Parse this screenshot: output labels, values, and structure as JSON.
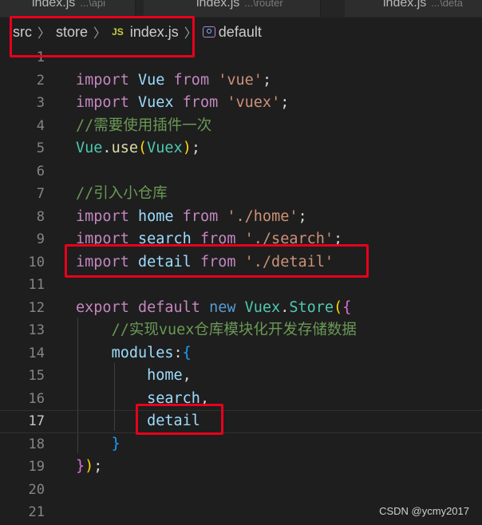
{
  "tabs": [
    {
      "name": "index.js",
      "desc": "...\\api"
    },
    {
      "name": "index.js",
      "desc": "...\\router"
    },
    {
      "name": "index.js",
      "desc": "...\\deta"
    }
  ],
  "breadcrumb": {
    "items": [
      "src",
      "store",
      "index.js",
      "default"
    ],
    "file_icon": "JS"
  },
  "editor": {
    "current_line": 17,
    "lines": [
      {
        "n": "1",
        "tokens": []
      },
      {
        "n": "2",
        "tokens": [
          [
            "kw",
            "import"
          ],
          [
            "pn",
            " "
          ],
          [
            "var",
            "Vue"
          ],
          [
            "pn",
            " "
          ],
          [
            "kw",
            "from"
          ],
          [
            "pn",
            " "
          ],
          [
            "str",
            "'vue'"
          ],
          [
            "pn",
            ";"
          ]
        ]
      },
      {
        "n": "3",
        "tokens": [
          [
            "kw",
            "import"
          ],
          [
            "pn",
            " "
          ],
          [
            "var",
            "Vuex"
          ],
          [
            "pn",
            " "
          ],
          [
            "kw",
            "from"
          ],
          [
            "pn",
            " "
          ],
          [
            "str",
            "'vuex'"
          ],
          [
            "pn",
            ";"
          ]
        ]
      },
      {
        "n": "4",
        "tokens": [
          [
            "cm",
            "//需要使用插件一次"
          ]
        ]
      },
      {
        "n": "5",
        "tokens": [
          [
            "cls",
            "Vue"
          ],
          [
            "pn",
            "."
          ],
          [
            "fn",
            "use"
          ],
          [
            "br1",
            "("
          ],
          [
            "cls",
            "Vuex"
          ],
          [
            "br1",
            ")"
          ],
          [
            "pn",
            ";"
          ]
        ]
      },
      {
        "n": "6",
        "tokens": []
      },
      {
        "n": "7",
        "tokens": [
          [
            "cm",
            "//引入小仓库"
          ]
        ]
      },
      {
        "n": "8",
        "tokens": [
          [
            "kw",
            "import"
          ],
          [
            "pn",
            " "
          ],
          [
            "var",
            "home"
          ],
          [
            "pn",
            " "
          ],
          [
            "kw",
            "from"
          ],
          [
            "pn",
            " "
          ],
          [
            "str",
            "'./home'"
          ],
          [
            "pn",
            ";"
          ]
        ]
      },
      {
        "n": "9",
        "tokens": [
          [
            "kw",
            "import"
          ],
          [
            "pn",
            " "
          ],
          [
            "var",
            "search"
          ],
          [
            "pn",
            " "
          ],
          [
            "kw",
            "from"
          ],
          [
            "pn",
            " "
          ],
          [
            "str",
            "'./search'"
          ],
          [
            "pn",
            ";"
          ]
        ]
      },
      {
        "n": "10",
        "tokens": [
          [
            "kw",
            "import"
          ],
          [
            "pn",
            " "
          ],
          [
            "var",
            "detail"
          ],
          [
            "pn",
            " "
          ],
          [
            "kw",
            "from"
          ],
          [
            "pn",
            " "
          ],
          [
            "str",
            "'./detail'"
          ]
        ]
      },
      {
        "n": "11",
        "tokens": []
      },
      {
        "n": "12",
        "tokens": [
          [
            "kw",
            "export"
          ],
          [
            "pn",
            " "
          ],
          [
            "kw",
            "default"
          ],
          [
            "pn",
            " "
          ],
          [
            "kwb",
            "new"
          ],
          [
            "pn",
            " "
          ],
          [
            "cls",
            "Vuex"
          ],
          [
            "pn",
            "."
          ],
          [
            "cls",
            "Store"
          ],
          [
            "br1",
            "("
          ],
          [
            "br2",
            "{"
          ]
        ]
      },
      {
        "n": "13",
        "tokens": [
          [
            "pn",
            "    "
          ],
          [
            "cm",
            "//实现vuex仓库模块化开发存储数据"
          ]
        ]
      },
      {
        "n": "14",
        "tokens": [
          [
            "pn",
            "    "
          ],
          [
            "var",
            "modules"
          ],
          [
            "pn",
            ":"
          ],
          [
            "br3",
            "{"
          ]
        ]
      },
      {
        "n": "15",
        "tokens": [
          [
            "pn",
            "        "
          ],
          [
            "var",
            "home"
          ],
          [
            "pn",
            ","
          ]
        ]
      },
      {
        "n": "16",
        "tokens": [
          [
            "pn",
            "        "
          ],
          [
            "var",
            "search"
          ],
          [
            "pn",
            ","
          ]
        ]
      },
      {
        "n": "17",
        "tokens": [
          [
            "pn",
            "        "
          ],
          [
            "var",
            "detail"
          ]
        ]
      },
      {
        "n": "18",
        "tokens": [
          [
            "pn",
            "    "
          ],
          [
            "br3",
            "}"
          ]
        ]
      },
      {
        "n": "19",
        "tokens": [
          [
            "br2",
            "}"
          ],
          [
            "br1",
            ")"
          ],
          [
            "pn",
            ";"
          ]
        ]
      },
      {
        "n": "20",
        "tokens": []
      },
      {
        "n": "21",
        "tokens": []
      }
    ]
  },
  "watermark": "CSDN @ycmy2017",
  "colors": {
    "background": "#1e1e1e",
    "keyword": "#c586c0",
    "variable": "#9cdcfe",
    "class": "#4ec9b0",
    "string": "#ce9178",
    "comment": "#6a9955",
    "highlight_box": "#e8001c"
  }
}
